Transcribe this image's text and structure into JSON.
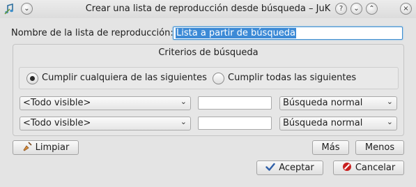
{
  "window": {
    "title": "Crear una lista de reproducción desde búsqueda – JuK",
    "icons": [
      "juk-app-icon",
      "window-menu-icon",
      "help-icon",
      "minimize-icon",
      "maximize-icon",
      "close-icon"
    ]
  },
  "form": {
    "name_label": "Nombre de la lista de reproducción:",
    "name_value": "Lista a partir de búsqueda"
  },
  "criteria": {
    "title": "Criterios de búsqueda",
    "match_any_label": "Cumplir cualquiera de las siguientes",
    "match_all_label": "Cumplir todas las siguientes",
    "selected": "match_any",
    "rows": [
      {
        "field": "<Todo visible>",
        "text": "",
        "mode": "Búsqueda normal"
      },
      {
        "field": "<Todo visible>",
        "text": "",
        "mode": "Búsqueda normal"
      }
    ]
  },
  "buttons": {
    "clear": "Limpiar",
    "more": "Más",
    "fewer": "Menos",
    "ok": "Aceptar",
    "cancel": "Cancelar"
  },
  "colors": {
    "selection": "#3c8ad6",
    "focus_border": "#3f8fd1",
    "ok_icon": "#2f5fa8",
    "cancel_icon": "#c82020"
  }
}
